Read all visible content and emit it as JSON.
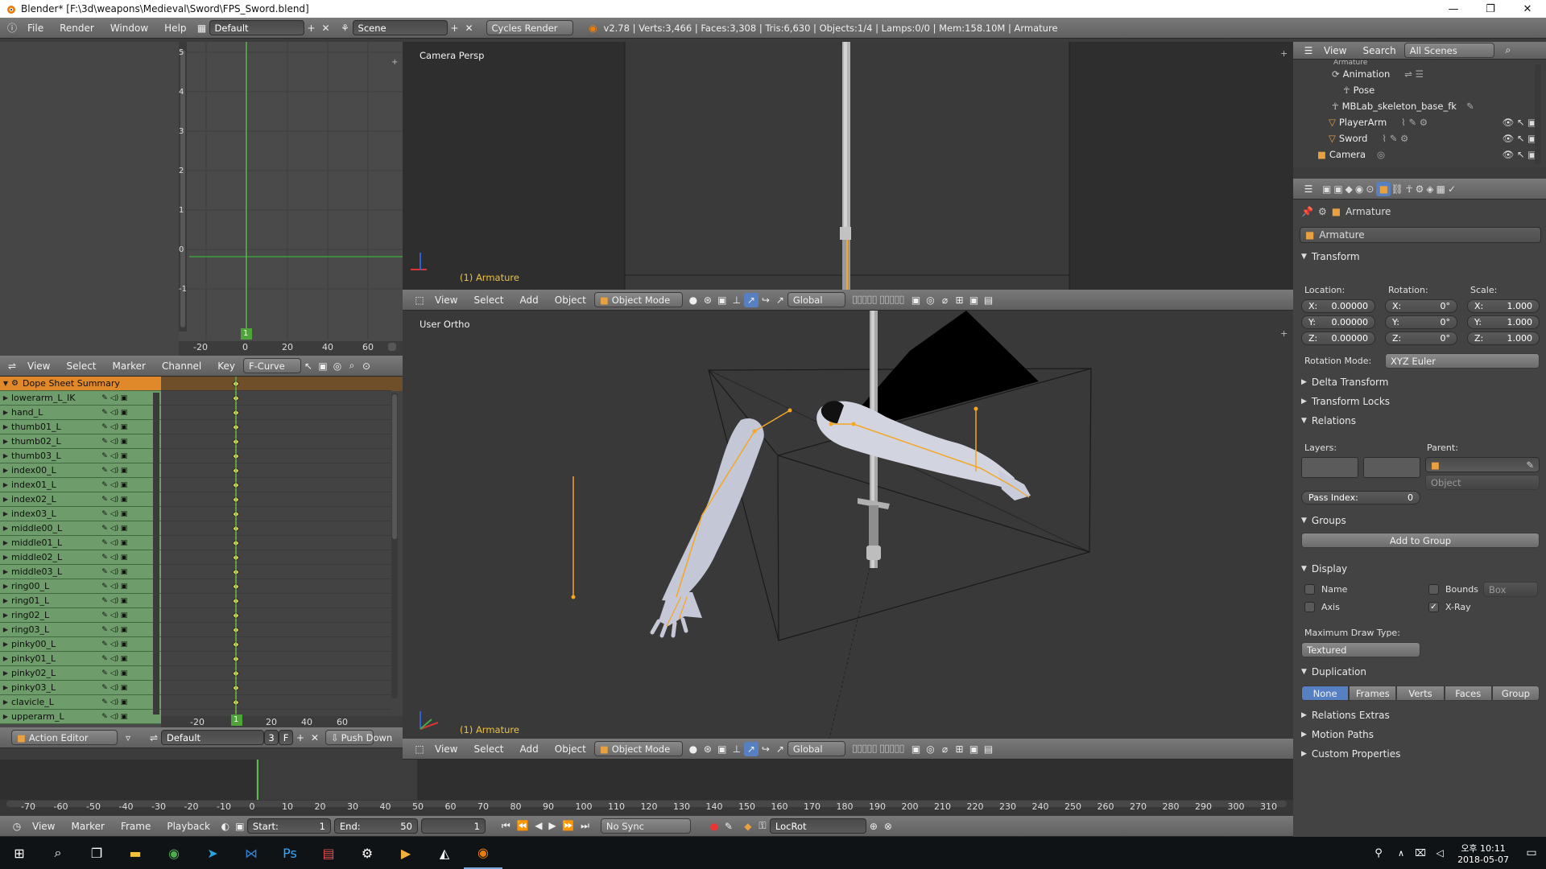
{
  "window": {
    "title": "Blender* [F:\\3d\\weapons\\Medieval\\Sword\\FPS_Sword.blend]",
    "minimize": "—",
    "maximize": "❐",
    "close": "✕"
  },
  "info_header": {
    "menus": [
      "File",
      "Render",
      "Window",
      "Help"
    ],
    "screen_layout": "Default",
    "scene": "Scene",
    "render_engine": "Cycles Render",
    "stats": "v2.78 | Verts:3,466 | Faces:3,308 | Tris:6,630 | Objects:1/4 | Lamps:0/0 | Mem:158.10M | Armature"
  },
  "graph": {
    "y_ticks": [
      "5",
      "4",
      "3",
      "2",
      "1",
      "0",
      "-1"
    ],
    "x_ticks": [
      "-20",
      "0",
      "20",
      "40",
      "60"
    ],
    "current_frame": "1"
  },
  "action_header": {
    "menus": [
      "View",
      "Select",
      "Marker",
      "Channel",
      "Key"
    ],
    "mode": "F-Curve"
  },
  "dopesheet": {
    "summary": "Dope Sheet Summary",
    "channels": [
      "lowerarm_L_IK",
      "hand_L",
      "thumb01_L",
      "thumb02_L",
      "thumb03_L",
      "index00_L",
      "index01_L",
      "index02_L",
      "index03_L",
      "middle00_L",
      "middle01_L",
      "middle02_L",
      "middle03_L",
      "ring00_L",
      "ring01_L",
      "ring02_L",
      "ring03_L",
      "pinky00_L",
      "pinky01_L",
      "pinky02_L",
      "pinky03_L",
      "clavicle_L",
      "upperarm_L"
    ],
    "x_ticks": [
      "-20",
      "0",
      "20",
      "40",
      "60"
    ],
    "current_frame": "1"
  },
  "ae_footer": {
    "editor": "Action Editor",
    "action": "Default",
    "users": "3",
    "fake": "F",
    "push_down": "Push Down"
  },
  "camera_view": {
    "label": "Camera Persp",
    "object": "(1) Armature"
  },
  "view_header": {
    "menus": [
      "View",
      "Select",
      "Add",
      "Object"
    ],
    "mode": "Object Mode",
    "orientation": "Global"
  },
  "user_view": {
    "label": "User Ortho",
    "object": "(1) Armature"
  },
  "timeline": {
    "ticks": [
      "-70",
      "-60",
      "-50",
      "-40",
      "-30",
      "-20",
      "-10",
      "0",
      "10",
      "20",
      "30",
      "40",
      "50",
      "60",
      "70",
      "80",
      "90",
      "100",
      "110",
      "120",
      "130",
      "140",
      "150",
      "160",
      "170",
      "180",
      "190",
      "200",
      "210",
      "220",
      "230",
      "240",
      "250",
      "260",
      "270",
      "280",
      "290",
      "300",
      "310"
    ],
    "menus": [
      "View",
      "Marker",
      "Frame",
      "Playback"
    ],
    "start_label": "Start:",
    "start": "1",
    "end_label": "End:",
    "end": "50",
    "current": "1",
    "sync": "No Sync",
    "keying_set": "LocRot"
  },
  "outliner": {
    "menus": [
      "View",
      "Search"
    ],
    "filter": "All Scenes",
    "items": [
      "Armature",
      "Animation",
      "Pose",
      "MBLab_skeleton_base_fk",
      "PlayerArm",
      "Sword",
      "Camera"
    ]
  },
  "properties": {
    "context_object": "Armature",
    "name_field": "Armature",
    "transform": {
      "title": "Transform",
      "location_label": "Location:",
      "rotation_label": "Rotation:",
      "scale_label": "Scale:",
      "location": [
        "X:",
        "0.00000",
        "Y:",
        "0.00000",
        "Z:",
        "0.00000"
      ],
      "rotation": [
        "X:",
        "0°",
        "Y:",
        "0°",
        "Z:",
        "0°"
      ],
      "scale": [
        "X:",
        "1.000",
        "Y:",
        "1.000",
        "Z:",
        "1.000"
      ],
      "rotation_mode_label": "Rotation Mode:",
      "rotation_mode": "XYZ Euler"
    },
    "delta_transform": "Delta Transform",
    "transform_locks": "Transform Locks",
    "relations": {
      "title": "Relations",
      "layers_label": "Layers:",
      "parent_label": "Parent:",
      "parent_type": "Object",
      "pass_index_label": "Pass Index:",
      "pass_index": "0"
    },
    "groups": {
      "title": "Groups",
      "add": "Add to Group"
    },
    "display": {
      "title": "Display",
      "name": "Name",
      "axis": "Axis",
      "bounds": "Bounds",
      "bounds_type": "Box",
      "xray": "X-Ray",
      "max_draw_label": "Maximum Draw Type:",
      "max_draw": "Textured"
    },
    "duplication": {
      "title": "Duplication",
      "options": [
        "None",
        "Frames",
        "Verts",
        "Faces",
        "Group"
      ]
    },
    "relations_extras": "Relations Extras",
    "motion_paths": "Motion Paths",
    "custom_properties": "Custom Properties"
  },
  "taskbar": {
    "time": "오후 10:11",
    "date": "2018-05-07"
  },
  "colors": {
    "accent_blue": "#5680c2",
    "summary_orange": "#e0892b",
    "channel_green": "#6e9c6a",
    "bone_orange": "#f5a623"
  }
}
